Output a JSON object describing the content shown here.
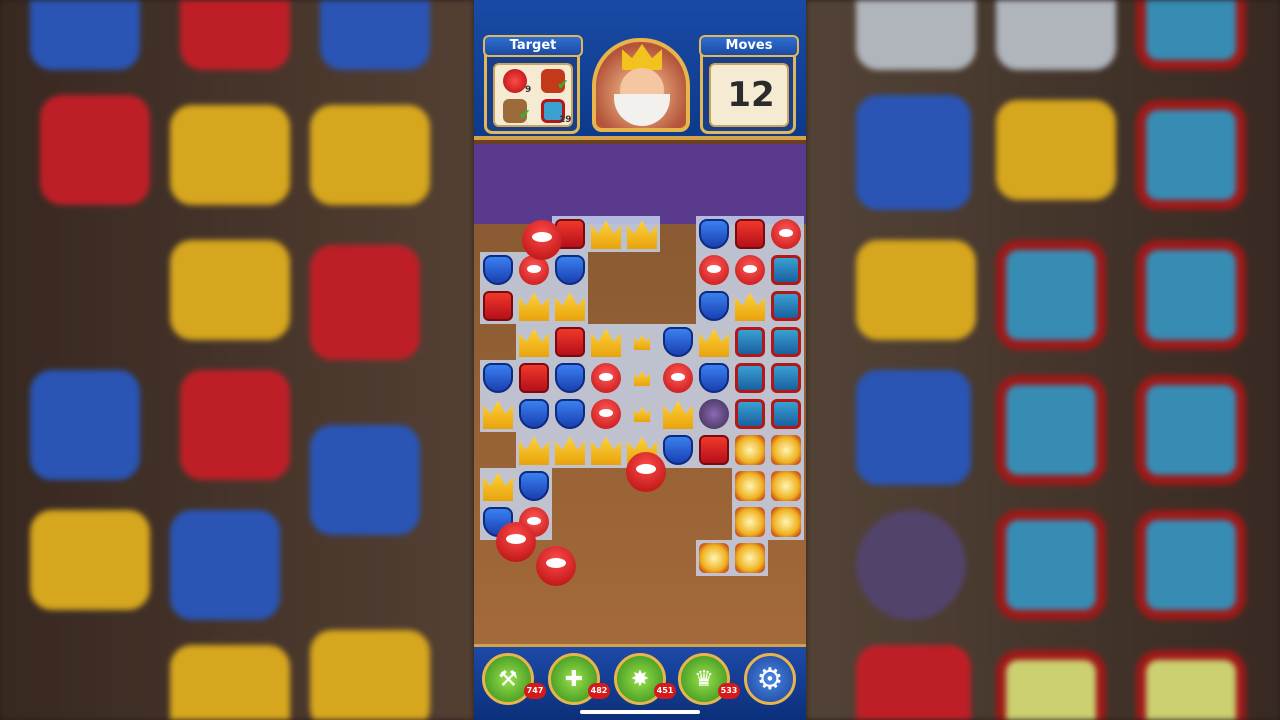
{
  "header": {
    "target_label": "Target",
    "moves_label": "Moves",
    "moves_value": "12"
  },
  "targets": [
    {
      "icon": "red-bird-icon",
      "count": "9",
      "done": false
    },
    {
      "icon": "birdhouse-icon",
      "count": "",
      "done": true
    },
    {
      "icon": "wood-crate-icon",
      "count": "",
      "done": true
    },
    {
      "icon": "lantern-icon",
      "count": "19",
      "done": false
    }
  ],
  "boosters": [
    {
      "icon": "hammer-icon",
      "glyph": "⚒",
      "count": "747"
    },
    {
      "icon": "arrows-icon",
      "glyph": "✚",
      "count": "482"
    },
    {
      "icon": "cannon-icon",
      "glyph": "✸",
      "count": "451"
    },
    {
      "icon": "jester-hat-icon",
      "glyph": "♛",
      "count": "533"
    }
  ],
  "settings_icon": "gear-icon",
  "colors": {
    "topbar": "#1a4aa6",
    "frame_gold": "#e0b75a",
    "red_piece": "#d8202a",
    "blue_piece": "#2a5fd0",
    "crown_piece": "#f4be1f"
  }
}
